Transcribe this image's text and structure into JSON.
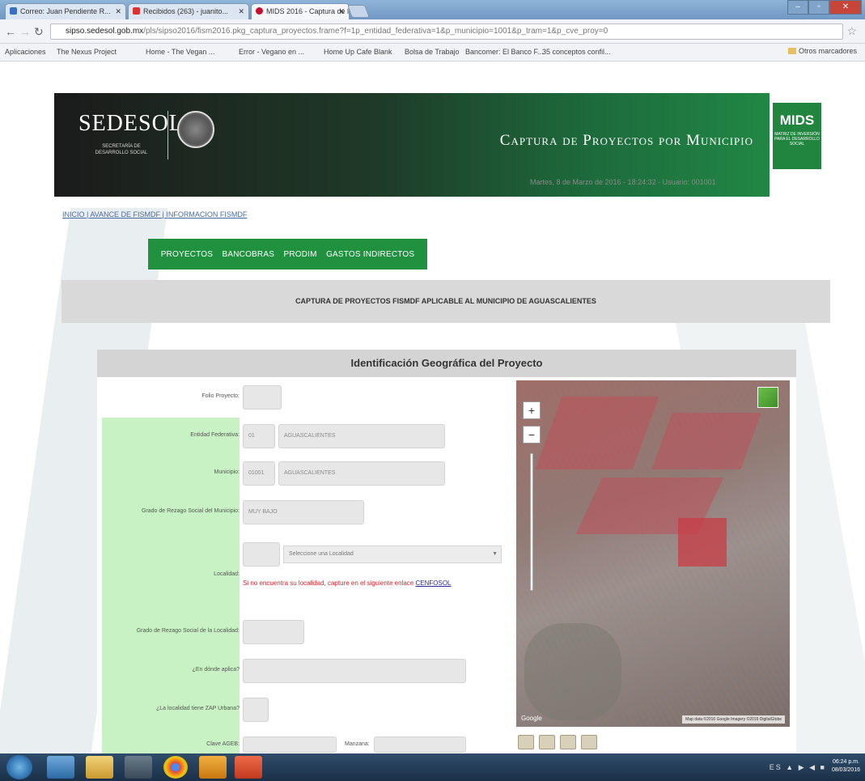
{
  "browser": {
    "tabs": [
      {
        "label": "Correo: Juan Pendiente R...",
        "active": false
      },
      {
        "label": "Recibidos (263) - juanito...",
        "active": false
      },
      {
        "label": "MIDS 2016 - Captura de l",
        "active": true
      }
    ],
    "url_host": "sipso.sedesol.gob.mx",
    "url_path": "/pls/sipso2016/fism2016.pkg_captura_proyectos.frame?f=1p_entidad_federativa=1&p_municipio=1001&p_tram=1&p_cve_proy=0",
    "bookmarks": [
      "Aplicaciones",
      "The Nexus Project",
      "Home - The Vegan ...",
      "Error - Vegano en ...",
      "Home Up Cafe Blank",
      "Bolsa de Trabajo",
      "Bancomer: El Banco F...",
      "35 conceptos confil..."
    ],
    "other_bookmarks": "Otros marcadores"
  },
  "header": {
    "brand": "SEDESOL",
    "brand_sub": "SECRETARÍA DE DESARROLLO SOCIAL",
    "title": "Captura de Proyectos por Municipio",
    "badge": "MIDS",
    "badge_sub": "MATRIZ DE INVERSIÓN PARA EL DESARROLLO SOCIAL",
    "date_line": "Martes, 8 de Marzo de 2016 - 18:24:32 - Usuario: 001001"
  },
  "breadcrumbs": "INICIO | AVANCE DE FISMDF | INFORMACION FISMDF",
  "menu": [
    "PROYECTOS",
    "BANCOBRAS",
    "PRODIM",
    "GASTOS INDIRECTOS"
  ],
  "banner": "CAPTURA DE PROYECTOS FISMDF APLICABLE AL MUNICIPIO DE AGUASCALIENTES",
  "panel": {
    "title": "Identificación Geográfica del Proyecto",
    "fields": {
      "folio_label": "Folio Proyecto:",
      "entidad_label": "Entidad Federativa:",
      "entidad_code": "01",
      "entidad_name": "AGUASCALIENTES",
      "municipio_label": "Municipio:",
      "municipio_code": "01001",
      "municipio_name": "AGUASCALIENTES",
      "grado_mun_label": "Grado de Rezago Social del Municipio:",
      "grado_mun_value": "MUY BAJO",
      "localidad_label": "Localidad:",
      "localidad_placeholder": "Seleccione una Localidad",
      "localidad_warning": "Si no encuentra su localidad, capture en el siguiente enlace",
      "localidad_link": "CENFOSOL",
      "grado_loc_label": "Grado de Rezago Social de la Localidad:",
      "zap_label": "¿En dónde aplica?",
      "cap_label": "¿La localidad tiene ZAP Urbana?",
      "ageb_label": "Clave AGEB:",
      "manzana_label": "Manzana:"
    },
    "map": {
      "zoom_in": "+",
      "zoom_out": "−",
      "attribution": "Map data ©2016 Google Imagery ©2016 DigitalGlobe",
      "google": "Google"
    }
  },
  "taskbar": {
    "tray": "ES ▲ ▶ ◀ ■",
    "time": "06:24 p.m.",
    "date": "08/03/2016"
  }
}
